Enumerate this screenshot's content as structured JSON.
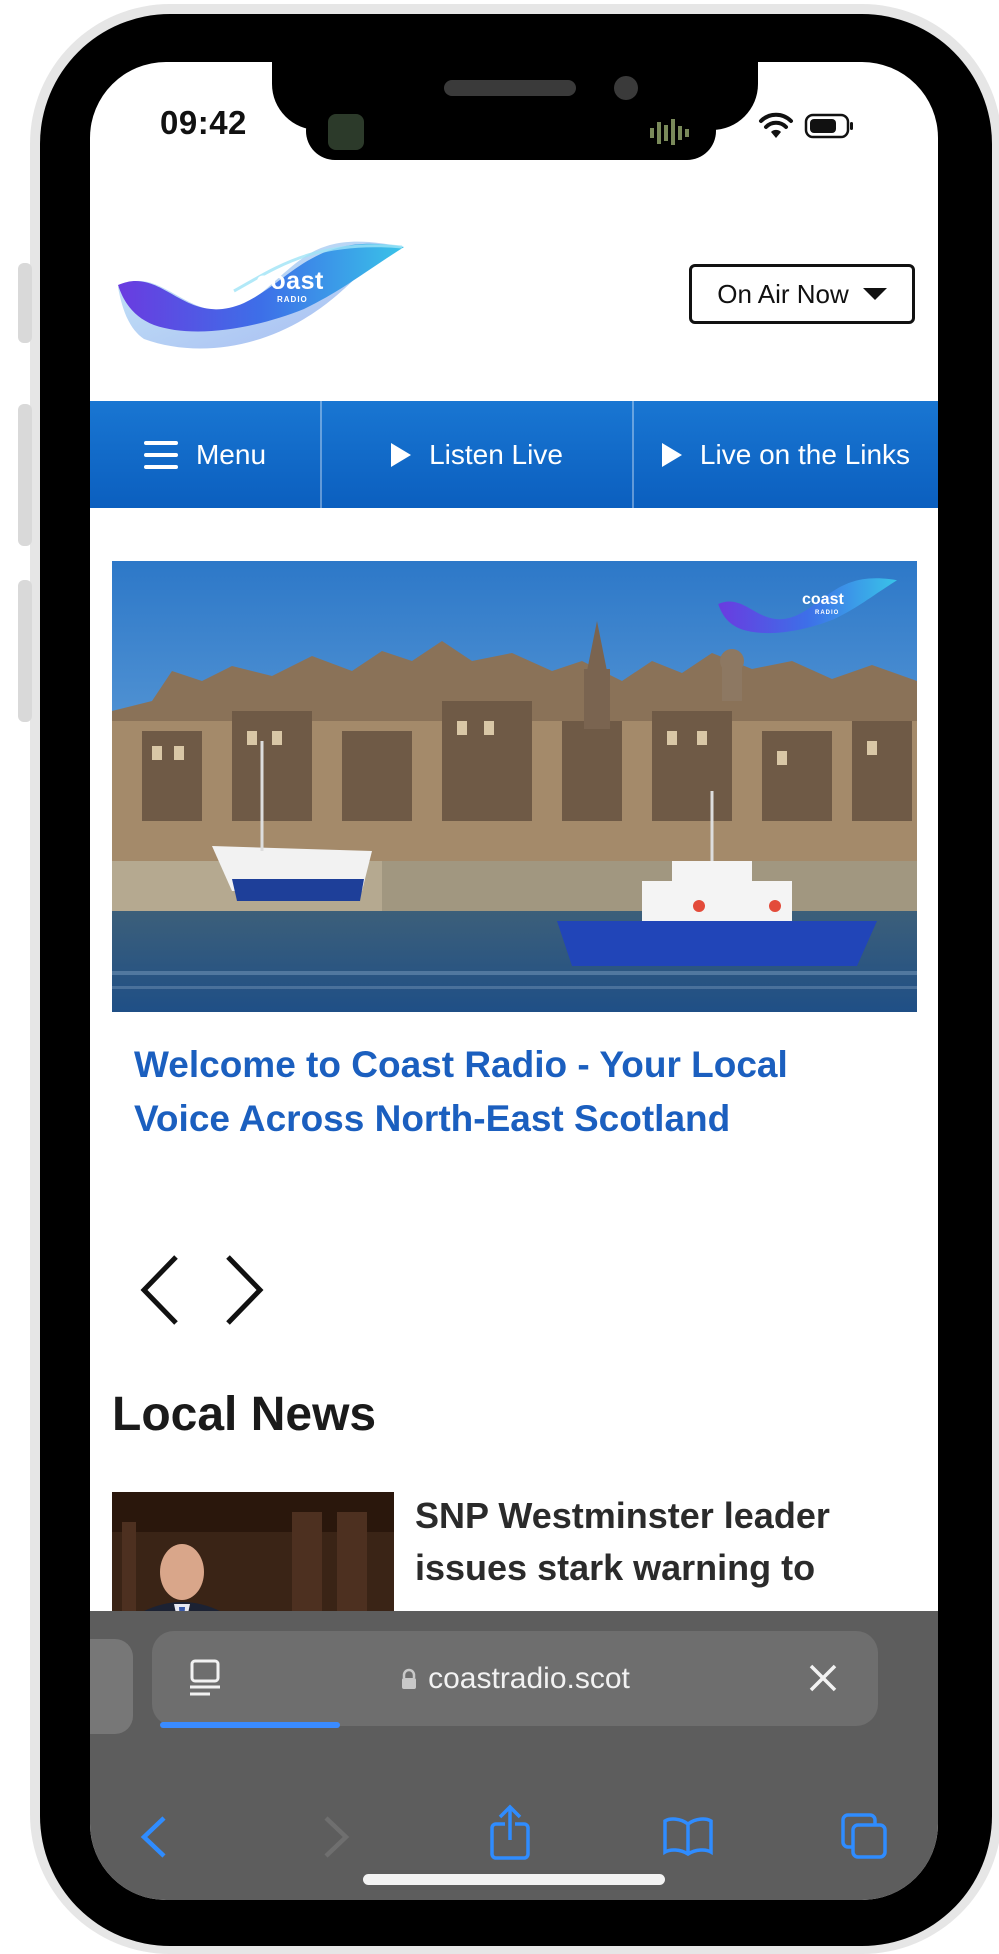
{
  "status_bar": {
    "time": "09:42"
  },
  "header": {
    "logo_text": "coast",
    "logo_subtext": "RADIO",
    "on_air_button": "On Air Now"
  },
  "nav": {
    "menu_label": "Menu",
    "listen_live_label": "Listen Live",
    "live_links_label": "Live on the Links"
  },
  "hero": {
    "logo_text": "coast",
    "logo_subtext": "RADIO",
    "title": "Welcome to Coast Radio - Your Local Voice Across North-East Scotland"
  },
  "local_news": {
    "section_title": "Local News",
    "items": [
      {
        "title": "SNP Westminster leader issues stark warning to"
      }
    ]
  },
  "browser": {
    "url": "coastradio.scot"
  },
  "colors": {
    "brand_blue": "#1b5fbf",
    "nav_blue": "#1976d2",
    "browser_chrome": "#5d5d5d",
    "browser_accent": "#3a8bff"
  }
}
